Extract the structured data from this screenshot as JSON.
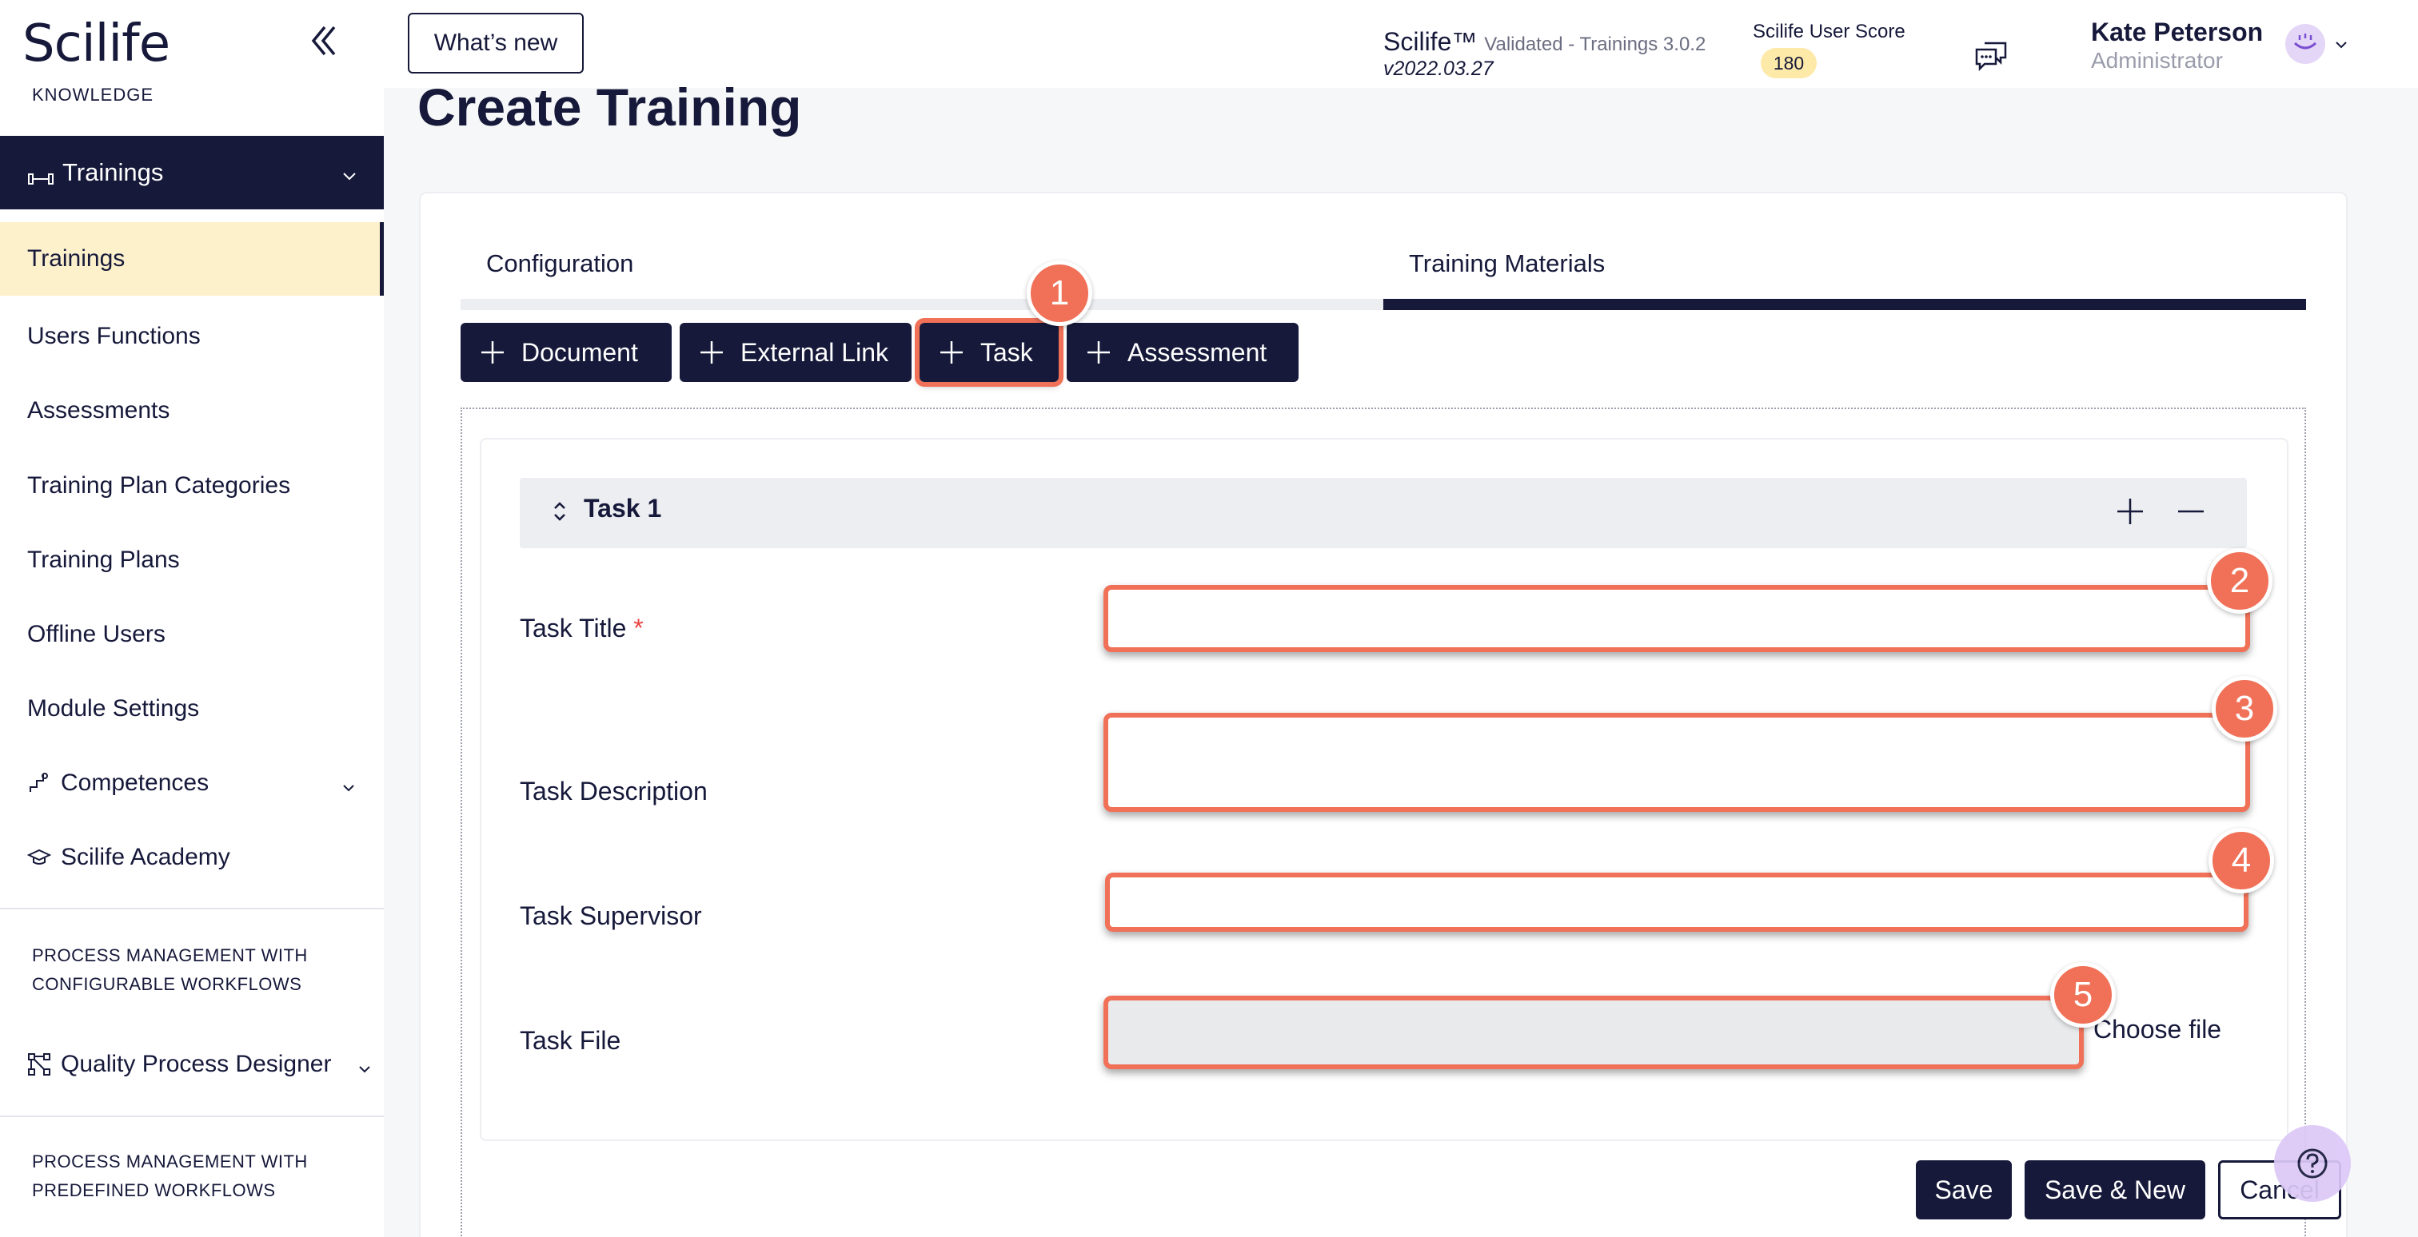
{
  "sidebar": {
    "logo": "Scilife",
    "logo_sub": "KNOWLEDGE",
    "section_head": "Trainings",
    "items": [
      {
        "label": "Trainings"
      },
      {
        "label": "Users Functions"
      },
      {
        "label": "Assessments"
      },
      {
        "label": "Training Plan Categories"
      },
      {
        "label": "Training Plans"
      },
      {
        "label": "Offline Users"
      },
      {
        "label": "Module Settings"
      }
    ],
    "groups": [
      {
        "label": "Competences",
        "icon": "competences-icon"
      },
      {
        "label": "Scilife Academy",
        "icon": "academy-icon"
      }
    ],
    "section1_line1": "PROCESS MANAGEMENT WITH",
    "section1_line2": "CONFIGURABLE WORKFLOWS",
    "qpd": "Quality Process Designer",
    "section2_line1": "PROCESS MANAGEMENT WITH",
    "section2_line2": "PREDEFINED WORKFLOWS"
  },
  "topbar": {
    "whats_new": "What’s new",
    "product": "Scilife™",
    "product_detail": "Validated - Trainings 3.0.2",
    "version": "v2022.03.27",
    "score_label": "Scilife User Score",
    "score_value": "180",
    "user_name": "Kate Peterson",
    "user_role": "Administrator"
  },
  "page": {
    "title": "Create Training",
    "tabs": [
      {
        "label": "Configuration"
      },
      {
        "label": "Training Materials"
      }
    ],
    "add_buttons": [
      {
        "label": "Document"
      },
      {
        "label": "External Link"
      },
      {
        "label": "Task"
      },
      {
        "label": "Assessment"
      }
    ],
    "task": {
      "header": "Task 1",
      "fields": {
        "title_label": "Task Title",
        "required_mark": "*",
        "description_label": "Task Description",
        "supervisor_label": "Task Supervisor",
        "file_label": "Task File",
        "choose_file": "Choose file"
      }
    },
    "steps": [
      "1",
      "2",
      "3",
      "4",
      "5"
    ],
    "footer": {
      "save": "Save",
      "save_new": "Save & New",
      "cancel": "Cancel"
    }
  },
  "colors": {
    "navy": "#16193a",
    "highlight": "#f07158",
    "active_bg": "#fdf1cc",
    "score_bg": "#fde9a8",
    "help_bg": "#dcc8f7"
  }
}
